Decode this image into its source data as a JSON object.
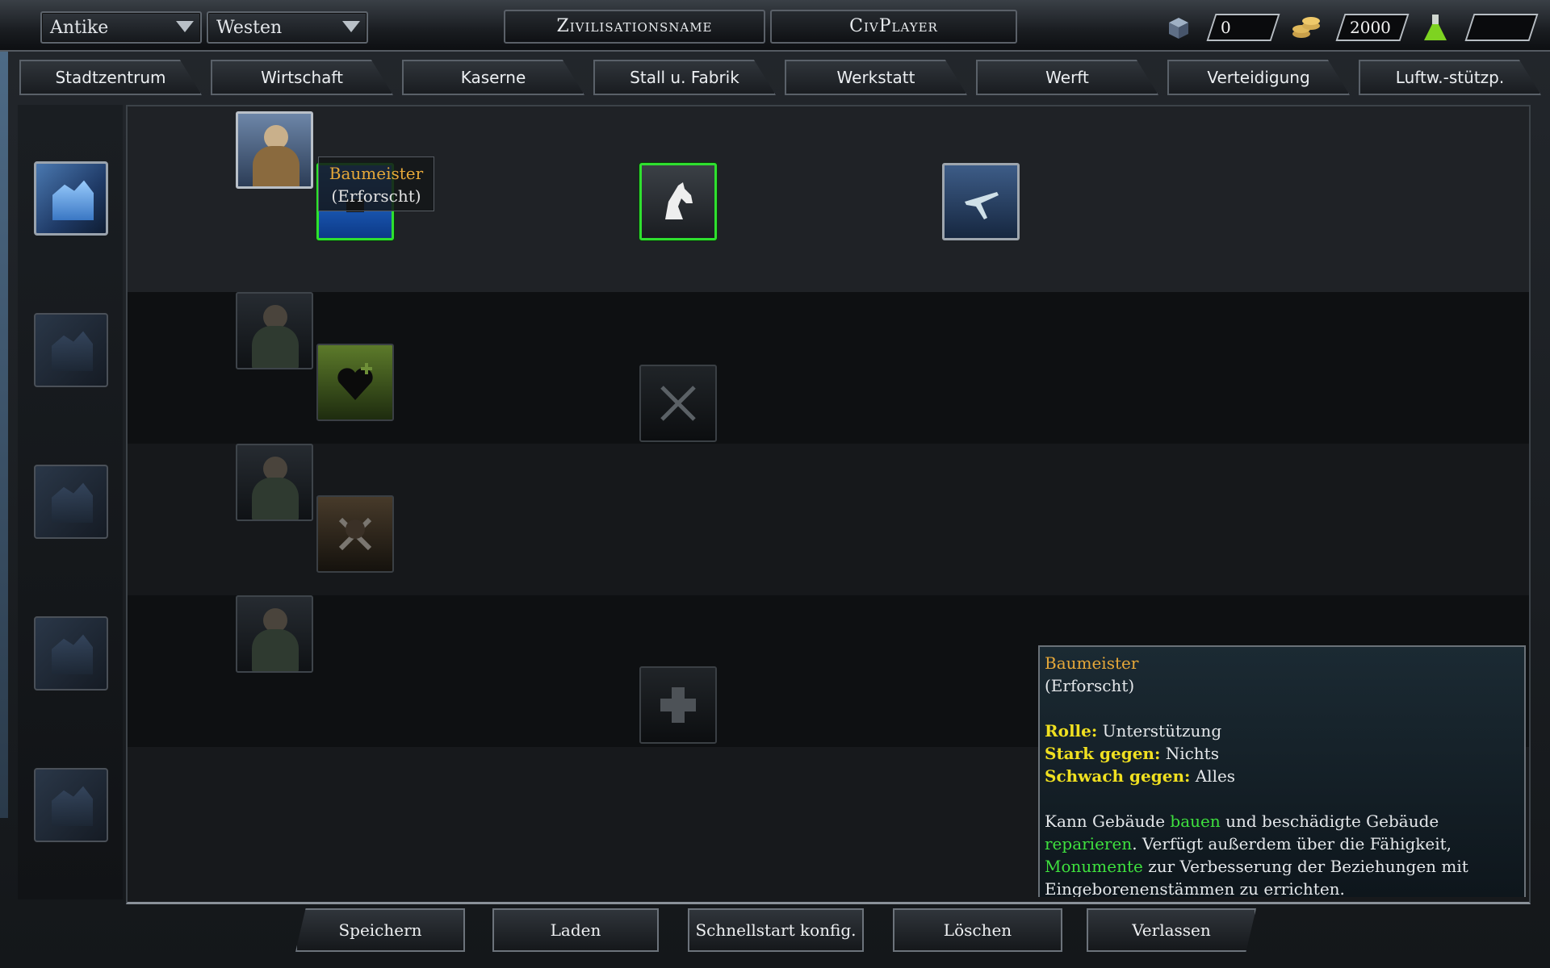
{
  "topbar": {
    "era": "Antike",
    "region": "Westen",
    "civ_name": "Zivilisationsname",
    "player_name": "CivPlayer",
    "resources": [
      {
        "icon": "supply-crates-icon",
        "value": "0"
      },
      {
        "icon": "gold-coins-icon",
        "value": "2000"
      },
      {
        "icon": "research-flask-icon",
        "value": ""
      }
    ]
  },
  "tabs": [
    "Stadtzentrum",
    "Wirtschaft",
    "Kaserne",
    "Stall u. Fabrik",
    "Werkstatt",
    "Werft",
    "Verteidigung",
    "Luftw.-stützp."
  ],
  "buildings": [
    {
      "icon": "city-center-icon",
      "active": true
    },
    {
      "icon": "economy-building-icon",
      "active": false
    },
    {
      "icon": "barracks-building-icon",
      "active": false
    },
    {
      "icon": "stable-building-icon",
      "active": false
    },
    {
      "icon": "workshop-building-icon",
      "active": false
    }
  ],
  "units": [
    {
      "icon": "builder-unit-icon",
      "row": 1,
      "state": "lit"
    },
    {
      "icon": "worker-unit-icon",
      "row": 2,
      "state": "dim"
    },
    {
      "icon": "soldier-unit-icon",
      "row": 3,
      "state": "dim"
    },
    {
      "icon": "scout-unit-icon",
      "row": 4,
      "state": "dim"
    }
  ],
  "upgrades": [
    {
      "icon": "builder-upgrade-icon",
      "state": "researched"
    },
    {
      "icon": "horse-upgrade-icon",
      "state": "researched"
    },
    {
      "icon": "aircraft-upgrade-icon",
      "state": "available"
    },
    {
      "icon": "heart-plus-upgrade-icon",
      "state": "locked"
    },
    {
      "icon": "crossed-swords-upgrade-icon",
      "state": "locked"
    },
    {
      "icon": "crossed-bones-upgrade-icon",
      "state": "locked"
    },
    {
      "icon": "medic-cross-upgrade-icon",
      "state": "locked"
    }
  ],
  "mini_tooltip": {
    "name": "Baumeister",
    "status": "(Erforscht)"
  },
  "info": {
    "name": "Baumeister",
    "status": "(Erforscht)",
    "role_label": "Rolle:",
    "role_value": "Unterstützung",
    "strong_label": "Stark gegen:",
    "strong_value": "Nichts",
    "weak_label": "Schwach gegen:",
    "weak_value": "Alles",
    "desc_1": "Kann Gebäude ",
    "desc_kw1": "bauen",
    "desc_2": " und beschädigte Gebäude ",
    "desc_kw2": "reparieren",
    "desc_3": ". Verfügt außerdem über die Fähigkeit, ",
    "desc_kw3": "Monumente",
    "desc_4": " zur Verbesserung der Beziehungen mit Eingeborenenstämmen zu errichten."
  },
  "buttons": {
    "save": "Speichern",
    "load": "Laden",
    "quickstart": "Schnellstart konfig.",
    "delete": "Löschen",
    "exit": "Verlassen"
  },
  "colors": {
    "researched_border": "#2fe02f",
    "tooltip_name": "#e6a839",
    "stat_label": "#f0e020",
    "keyword": "#3ee03e"
  }
}
